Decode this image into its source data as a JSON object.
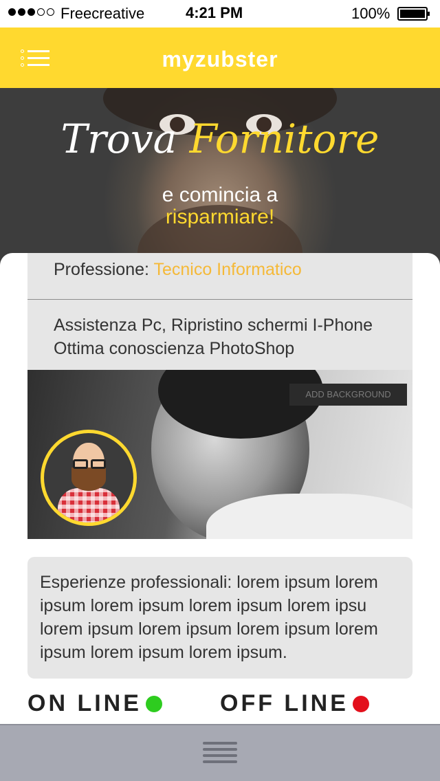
{
  "status_bar": {
    "carrier": "Freecreative",
    "time": "4:21 PM",
    "battery": "100%"
  },
  "header": {
    "brand": "myzubster"
  },
  "hero": {
    "title_part1": "Trova",
    "title_part2": "Fornitore",
    "subtitle_line1": "e comincia a",
    "subtitle_line2": "risparmiare!"
  },
  "profile": {
    "profession_label": "Professione:",
    "profession_value": "Tecnico Informatico",
    "description_line1": "Assistenza Pc, Ripristino schermi I-Phone",
    "description_line2": "Ottima conoscienza PhotoShop",
    "add_background_label": "ADD BACKGROUND",
    "experience": "Esperienze professionali: lorem ipsum lorem ipsum lorem ipsum lorem ipsum lorem ipsu lorem ipsum lorem ipsum lorem ipsum lorem ipsum lorem ipsum lorem ipsum."
  },
  "status": {
    "online_label": "ON LINE",
    "offline_label": "OFF LINE",
    "online_color": "#2ecc1f",
    "offline_color": "#e3101c"
  },
  "colors": {
    "accent": "#ffd92f",
    "highlight_text": "#f5b938"
  },
  "icons": {
    "menu": "menu-list-icon",
    "bottom_handle": "hamburger-handle-icon"
  }
}
